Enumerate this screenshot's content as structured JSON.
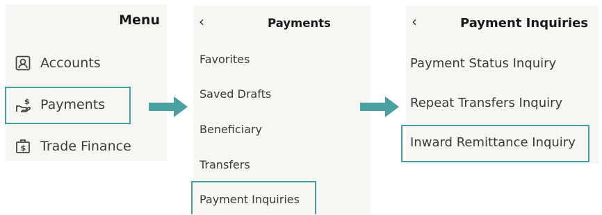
{
  "menu": {
    "title": "Menu",
    "items": [
      {
        "label": "Accounts",
        "icon": "accounts-icon"
      },
      {
        "label": "Payments",
        "icon": "payments-icon"
      },
      {
        "label": "Trade Finance",
        "icon": "trade-finance-icon"
      }
    ]
  },
  "payments": {
    "title": "Payments",
    "back_icon": "chevron-left-icon",
    "items": [
      {
        "label": "Favorites"
      },
      {
        "label": "Saved Drafts"
      },
      {
        "label": "Beneficiary"
      },
      {
        "label": "Transfers"
      },
      {
        "label": "Payment Inquiries"
      }
    ]
  },
  "inquiries": {
    "title": "Payment Inquiries",
    "back_icon": "chevron-left-icon",
    "items": [
      {
        "label": "Payment Status Inquiry"
      },
      {
        "label": "Repeat Transfers Inquiry"
      },
      {
        "label": "Inward Remittance Inquiry"
      }
    ]
  },
  "colors": {
    "highlight": "#3e9ea0",
    "panel_bg": "#f8f6f3",
    "arrow": "#4a9fa3"
  }
}
